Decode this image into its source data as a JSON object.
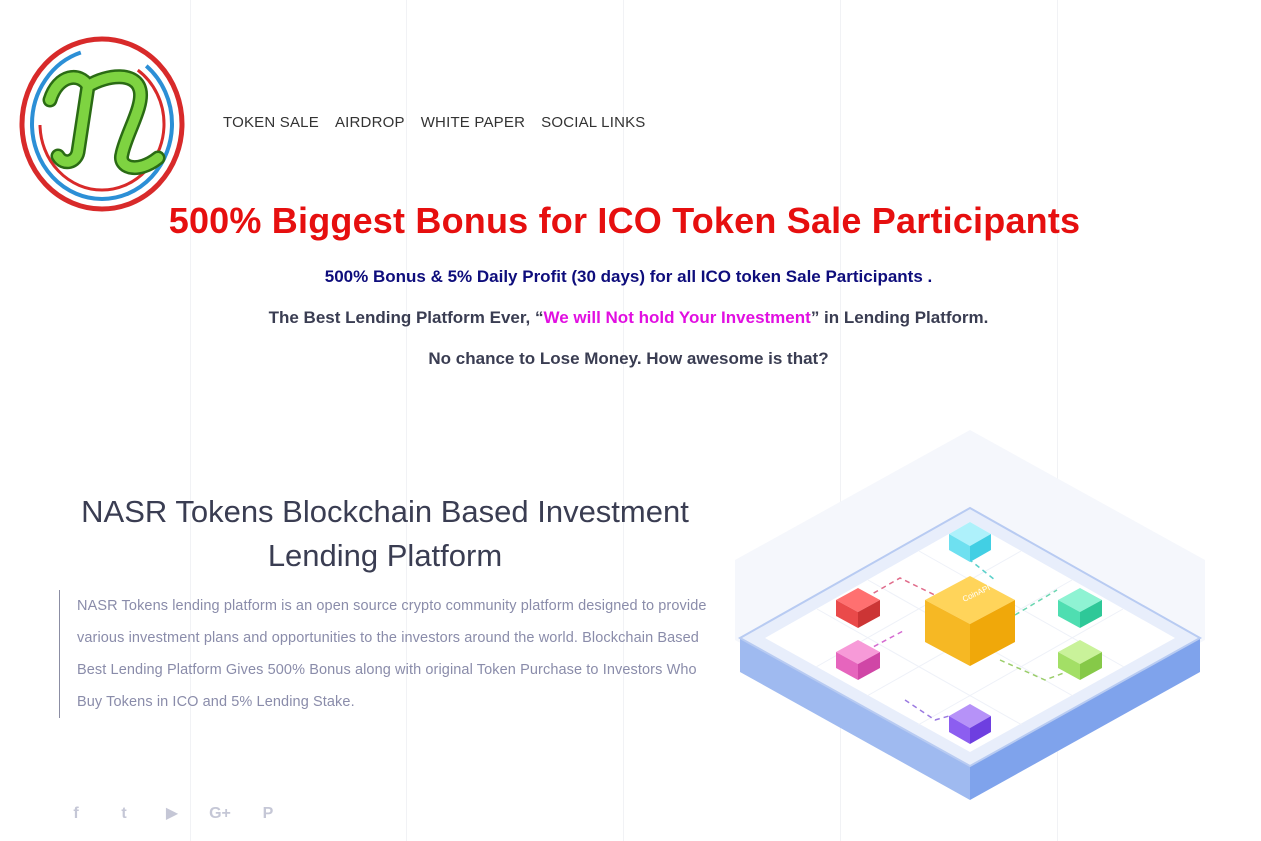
{
  "nav": {
    "items": [
      "TOKEN SALE",
      "AIRDROP",
      "WHITE PAPER",
      "SOCIAL LINKS"
    ]
  },
  "hero": {
    "headline": "500% Biggest Bonus for ICO Token Sale Participants",
    "line1": "500% Bonus & 5% Daily Profit (30 days) for all ICO token Sale Participants .",
    "line2_prefix": "The Best Lending Platform Ever, “",
    "line2_highlight": "We will Not hold Your Investment",
    "line2_suffix": "” in Lending Platform.",
    "line3": "No chance to Lose Money. How awesome is that?"
  },
  "section": {
    "title": "NASR Tokens Blockchain Based Investment Lending Platform",
    "body": "NASR Tokens lending platform is an open source crypto community platform designed to provide various investment plans and opportunities to the investors around the world. Blockchain Based Best Lending Platform Gives 500% Bonus along with original Token Purchase to Investors Who Buy Tokens in ICO and 5% Lending Stake."
  },
  "illustration": {
    "center_label": "CoinAPI"
  },
  "social": {
    "icons": [
      "facebook-icon",
      "twitter-icon",
      "youtube-icon",
      "google-plus-icon",
      "pinterest-icon"
    ],
    "glyphs": [
      "f",
      "t",
      "▶",
      "G+",
      "P"
    ]
  },
  "colors": {
    "headline": "#e60f0f",
    "line1": "#0e0d7c",
    "highlight": "#e10fe1",
    "text_dark": "#3a3d52",
    "text_muted": "#8a8caa"
  }
}
